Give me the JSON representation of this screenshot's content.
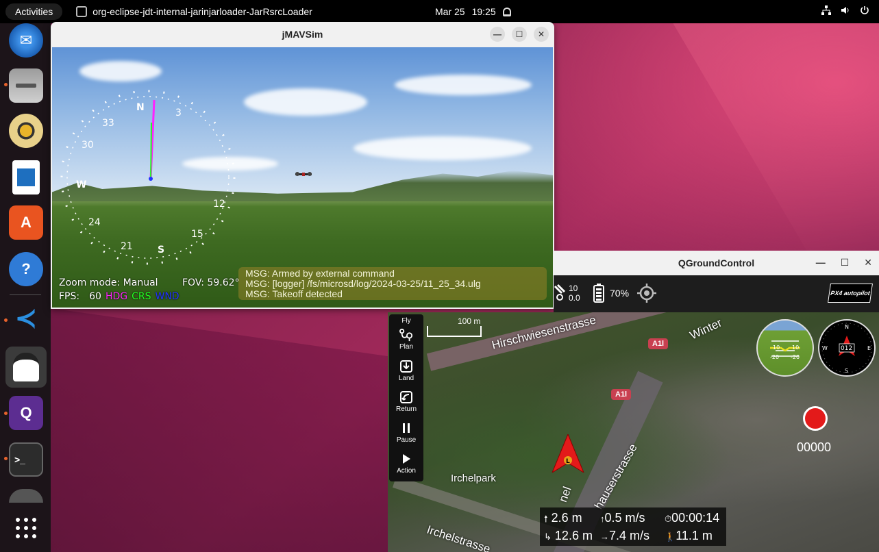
{
  "topbar": {
    "activities": "Activities",
    "app_name": "org-eclipse-jdt-internal-jarinjarloader-JarRsrcLoader",
    "date": "Mar 25",
    "time": "19:25"
  },
  "dock": {
    "items": [
      "thunderbird-icon",
      "files-icon",
      "rhythmbox-icon",
      "libreoffice-writer-icon",
      "app-center-icon",
      "help-icon",
      "vscode-icon",
      "java-icon",
      "qgroundcontrol-icon",
      "terminal-icon",
      "app-grid-icon"
    ]
  },
  "jmavsim": {
    "title": "jMAVSim",
    "hud": {
      "zoom_mode": "Zoom mode: Manual",
      "fov": "FOV: 59.62°",
      "fps_label": "FPS:",
      "fps_value": "60",
      "legend_hdg": "HDG",
      "legend_crs": "CRS",
      "legend_wnd": "WND",
      "compass_labels": {
        "n": "N",
        "e": "3",
        "w": "W",
        "s": "S",
        "w30": "30",
        "w33": "33",
        "s24": "24",
        "s21": "21",
        "s15": "15",
        "s12": "12"
      }
    },
    "messages": [
      "MSG: Armed by external command",
      "MSG: [logger] /fs/microsd/log/2024-03-25/11_25_34.ulg",
      "MSG: Takeoff detected"
    ],
    "colors": {
      "hdg": "#ff22ff",
      "crs": "#22ff22",
      "wnd": "#2233ff"
    }
  },
  "qgc": {
    "title": "QGroundControl",
    "toolbar": {
      "satellites": "10",
      "hdop": "0.0",
      "battery": "70%",
      "logo": "PX4 autopilot"
    },
    "leftbar": [
      {
        "label": "Fly",
        "icon": ""
      },
      {
        "label": "Plan",
        "icon": "plan-icon"
      },
      {
        "label": "Land",
        "icon": "land-icon"
      },
      {
        "label": "Return",
        "icon": "return-icon"
      },
      {
        "label": "Pause",
        "icon": "pause-icon"
      },
      {
        "label": "Action",
        "icon": "play-icon"
      }
    ],
    "map": {
      "scale": "100 m",
      "labels": {
        "hirschwiesen": "Hirschwiesenstrasse",
        "winter": "Winter",
        "a1l_1": "A1l",
        "a1l_2": "A1l",
        "irchelpark": "Irchelpark",
        "irchelstrasse": "Irchelstrasse",
        "nel": "nel",
        "schaffhauser": "hauserstrasse"
      }
    },
    "attitude": {
      "pitch_up": "10",
      "pitch_down": "-20",
      "pitch_up_r": "10",
      "pitch_down_r": "-20"
    },
    "compass": {
      "heading": "012",
      "n": "N",
      "e": "E",
      "s": "S",
      "w": "W"
    },
    "recording": {
      "counter": "00000"
    },
    "telemetry": {
      "altitude": "2.6 m",
      "vertical_speed": "0.5 m/s",
      "flight_time": "00:00:14",
      "distance": "12.6 m",
      "ground_speed": "7.4 m/s",
      "distance_to_home": "11.1 m"
    },
    "vehicle_marker": "L"
  }
}
